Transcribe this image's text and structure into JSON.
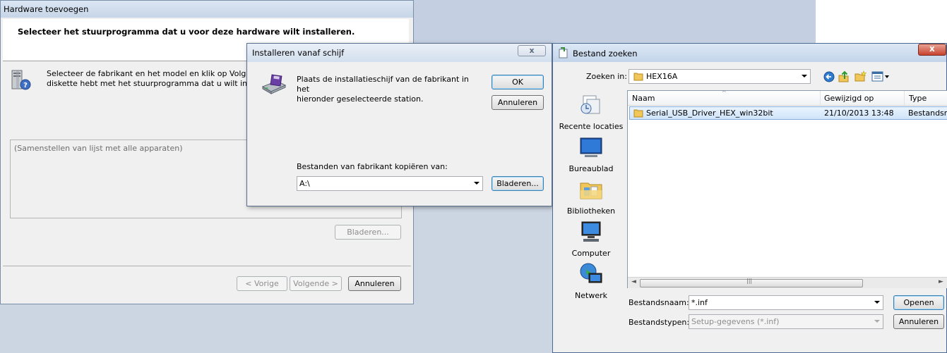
{
  "wizard": {
    "title": "Hardware toevoegen",
    "header_text": "Selecteer het stuurprogramma dat u voor deze hardware wilt installeren.",
    "instruction_line1": "Selecteer de fabrikant en het model en klik op Volgend",
    "instruction_line2": "diskette hebt met het stuurprogramma dat u wilt insta",
    "list_placeholder": "(Samenstellen van lijst met alle apparaten)",
    "browse_label": "Bladeren...",
    "back_label": "< Vorige",
    "next_label": "Volgende >",
    "cancel_label": "Annuleren"
  },
  "install_dialog": {
    "title": "Installeren vanaf schijf",
    "message_line1": "Plaats de installatieschijf van de fabrikant in het",
    "message_line2": "hieronder geselecteerde station.",
    "ok_label": "OK",
    "cancel_label": "Annuleren",
    "copy_from_label": "Bestanden van fabrikant kopiëren van:",
    "copy_from_value": "A:\\",
    "browse_label": "Bladeren...",
    "close_glyph": "x"
  },
  "file_dialog": {
    "title": "Bestand zoeken",
    "close_glyph": "x",
    "look_in_label": "Zoeken in:",
    "look_in_value": "HEX16A",
    "places": [
      {
        "label": "Recente locaties",
        "icon": "recent-locations-icon"
      },
      {
        "label": "Bureaublad",
        "icon": "desktop-icon"
      },
      {
        "label": "Bibliotheken",
        "icon": "libraries-icon"
      },
      {
        "label": "Computer",
        "icon": "computer-icon"
      },
      {
        "label": "Netwerk",
        "icon": "network-icon"
      }
    ],
    "columns": {
      "name": "Naam",
      "modified": "Gewijzigd op",
      "type": "Type"
    },
    "rows": [
      {
        "name": "Serial_USB_Driver_HEX_win32bit",
        "modified": "21/10/2013 13:48",
        "type": "Bestandsm"
      }
    ],
    "filename_label": "Bestandsnaam:",
    "filename_value": "*.inf",
    "filetype_label": "Bestandstypen:",
    "filetype_value": "Setup-gegevens (*.inf)",
    "open_label": "Openen",
    "cancel_label": "Annuleren"
  }
}
